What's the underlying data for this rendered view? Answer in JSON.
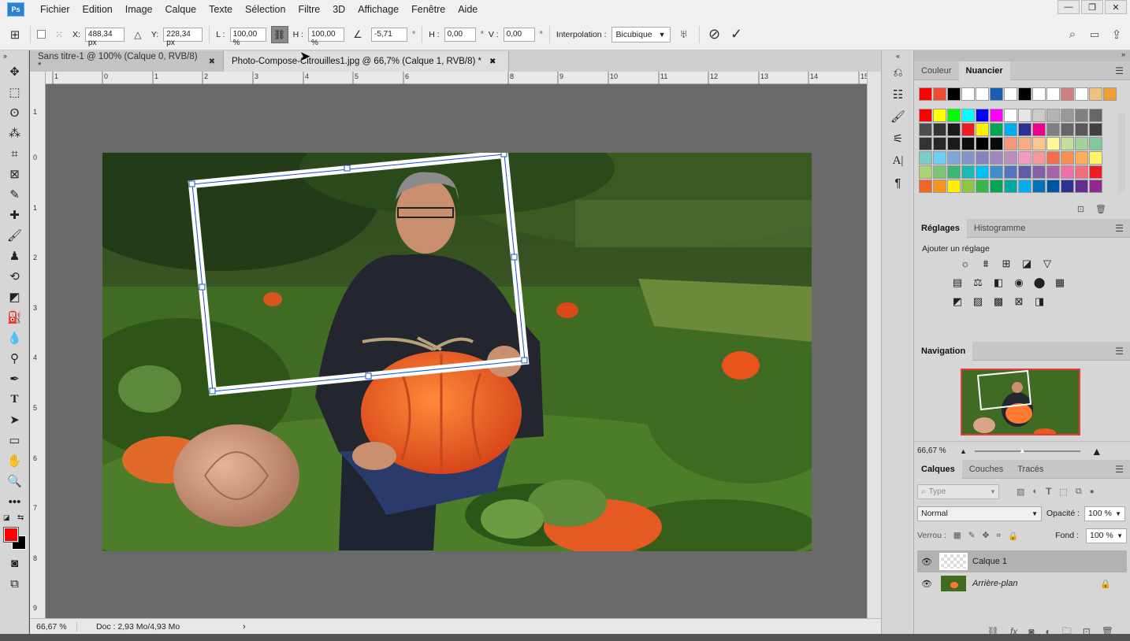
{
  "menubar": {
    "logo": "Ps",
    "items": [
      "Fichier",
      "Edition",
      "Image",
      "Calque",
      "Texte",
      "Sélection",
      "Filtre",
      "3D",
      "Affichage",
      "Fenêtre",
      "Aide"
    ]
  },
  "window_controls": {
    "minimize": "—",
    "maximize": "❐",
    "close": "✕"
  },
  "options": {
    "x_label": "X:",
    "x_value": "488,34 px",
    "y_label": "Y:",
    "y_value": "228,34 px",
    "w_label": "L :",
    "w_value": "100,00 %",
    "h_label": "H :",
    "h_value": "100,00 %",
    "angle_value": "-5,71",
    "deg": "°",
    "hskew_label": "H :",
    "hskew_value": "0,00",
    "vskew_label": "V :",
    "vskew_value": "0,00",
    "interp_label": "Interpolation :",
    "interp_value": "Bicubique"
  },
  "tabs": [
    {
      "label": "Sans titre-1 @ 100% (Calque 0, RVB/8) *"
    },
    {
      "label": "Photo-Compose-Citrouilles1.jpg @ 66,7% (Calque 1, RVB/8) *"
    }
  ],
  "ruler_top": [
    "1",
    "0",
    "1",
    "2",
    "3",
    "4",
    "5",
    "6",
    "7",
    "8",
    "9",
    "10",
    "11",
    "12",
    "13",
    "14",
    "15"
  ],
  "ruler_left": [
    "1",
    "0",
    "1",
    "2",
    "3",
    "4",
    "5",
    "6",
    "7",
    "8",
    "9"
  ],
  "status": {
    "zoom": "66,67 %",
    "doc": "Doc : 2,93 Mo/4,93 Mo"
  },
  "swatches_panel": {
    "tabs": [
      "Couleur",
      "Nuancier"
    ],
    "recent": [
      "#ff0000",
      "#f04a30",
      "#000000",
      "#ffffff",
      "#ffffff",
      "#1a5fb4",
      "#ffffff",
      "#000000",
      "#ffffff",
      "#ffffff",
      "#d08080",
      "#ffffff",
      "#f0c080",
      "#f0a030"
    ],
    "grid": [
      [
        "#ff0000",
        "#ffff00",
        "#00ff00",
        "#00ffff",
        "#0000ff",
        "#ff00ff",
        "#ffffff",
        "#e6e6e6",
        "#cccccc",
        "#b3b3b3",
        "#999999",
        "#808080",
        "#666666"
      ],
      [
        "#4d4d4d",
        "#333333",
        "#1a1a1a",
        "#ed1c24",
        "#fff200",
        "#00a651",
        "#00aeef",
        "#2e3192",
        "#ec008c",
        "#808080",
        "#666666",
        "#595959",
        "#404040"
      ],
      [
        "#333333",
        "#262626",
        "#1a1a1a",
        "#0d0d0d",
        "#000000",
        "#0a0a0a",
        "#f7977a",
        "#f9ad81",
        "#fdc68a",
        "#fff79a",
        "#c4df9b",
        "#a2d39c",
        "#82ca9d"
      ],
      [
        "#7bcdc8",
        "#6ecff6",
        "#7ea7d8",
        "#8493ca",
        "#8882be",
        "#a187be",
        "#bc8dbf",
        "#f49ac2",
        "#f6989d",
        "#f26c4f",
        "#f68e55",
        "#fbaf5c",
        "#fff467"
      ],
      [
        "#acd372",
        "#7cc576",
        "#3bb878",
        "#1abbb4",
        "#00bff3",
        "#438ccb",
        "#5574b9",
        "#605ca8",
        "#855fa8",
        "#a763a8",
        "#f06eaa",
        "#f26d7d",
        "#ed1c24"
      ],
      [
        "#f26522",
        "#f7941d",
        "#fff200",
        "#8dc63f",
        "#39b54a",
        "#00a651",
        "#00a99d",
        "#00aeef",
        "#0072bc",
        "#0054a6",
        "#2e3192",
        "#662d91",
        "#92278f"
      ]
    ]
  },
  "adjustments": {
    "tabs": [
      "Réglages",
      "Histogramme"
    ],
    "title": "Ajouter un réglage"
  },
  "navigation": {
    "tab": "Navigation",
    "zoom": "66,67 %"
  },
  "layers_panel": {
    "tabs": [
      "Calques",
      "Couches",
      "Tracés"
    ],
    "filter": "Type",
    "blend": "Normal",
    "opacity_label": "Opacité :",
    "opacity": "100 %",
    "lock_label": "Verrou :",
    "fill_label": "Fond :",
    "fill": "100 %",
    "layers": [
      {
        "name": "Calque 1"
      },
      {
        "name": "Arrière-plan"
      }
    ]
  }
}
